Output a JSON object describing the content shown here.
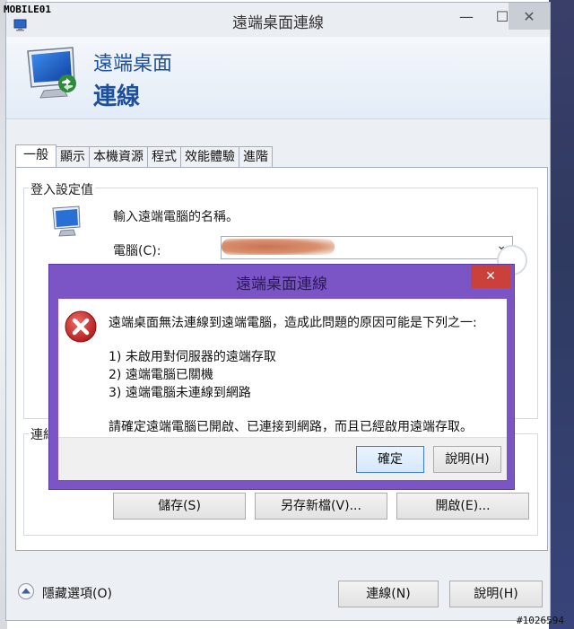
{
  "watermark_top": "MOBILE01",
  "window": {
    "title": "遠端桌面連線",
    "min_glyph": "—",
    "max_glyph": "☐",
    "close_glyph": "✕"
  },
  "banner": {
    "line1": "遠端桌面",
    "line2": "連線"
  },
  "tabs": [
    "一般",
    "顯示",
    "本機資源",
    "程式",
    "效能體驗",
    "進階"
  ],
  "login": {
    "group_label": "登入設定值",
    "prompt": "輸入遠端電腦的名稱。",
    "computer_label": "電腦(C):",
    "dropdown_glyph": "⌄"
  },
  "connection_settings": {
    "group_label_fragment": "連絡",
    "save_label": "儲存(S)",
    "save_as_label": "另存新檔(V)...",
    "open_label": "開啟(E)..."
  },
  "error_dialog": {
    "title": "遠端桌面連線",
    "close_glyph": "✕",
    "message": "遠端桌面無法連線到遠端電腦，造成此問題的原因可能是下列之一:",
    "reasons": [
      "1) 未啟用對伺服器的遠端存取",
      "2) 遠端電腦已關機",
      "3) 遠端電腦未連線到網路"
    ],
    "advice": "請確定遠端電腦已開啟、已連接到網路，而且已經啟用遠端存取。",
    "ok_label": "確定",
    "help_label": "說明(H)"
  },
  "footer": {
    "hide_options_label": "隱藏選項(O)",
    "connect_label": "連線(N)",
    "help_label": "說明(H)"
  },
  "watermark_bottom": "#1026594"
}
